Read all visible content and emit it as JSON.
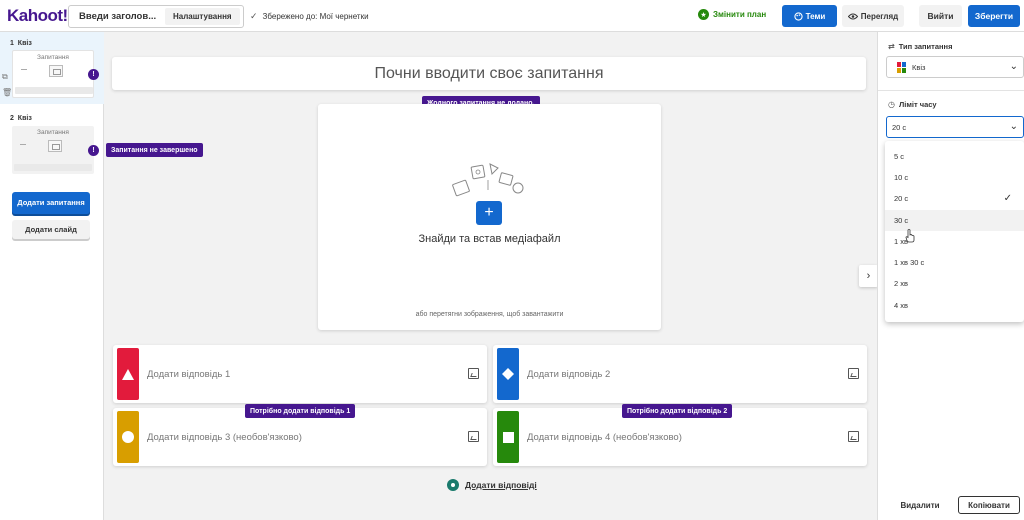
{
  "header": {
    "logo": "Kahoot!",
    "title_input": "Введи заголов...",
    "settings_label": "Налаштування",
    "saved_text": "Збережено до: Мої чернетки",
    "upgrade_label": "Змінити план",
    "themes_label": "Теми",
    "preview_label": "Перегляд",
    "exit_label": "Вийти",
    "save_label": "Зберегти"
  },
  "sidebar": {
    "slides": [
      {
        "number": "1",
        "type": "Квіз",
        "thumb_title": "Запитання",
        "warning_count": "!"
      },
      {
        "number": "2",
        "type": "Квіз",
        "thumb_title": "Запитання",
        "warning_count": "!"
      }
    ],
    "add_question_label": "Додати запитання",
    "add_slide_label": "Додати слайд",
    "incomplete_tooltip": "Запитання не завершено"
  },
  "editor": {
    "question_placeholder": "Почни вводити своє запитання",
    "no_question_tooltip": "Жодного запитання не додано.",
    "media_title": "Знайди та встав медіафайл",
    "media_hint": "або перетягни зображення, щоб завантажити",
    "answers": [
      {
        "placeholder": "Додати відповідь 1",
        "color": "#e21b3c",
        "shape": "triangle"
      },
      {
        "placeholder": "Додати відповідь 2",
        "color": "#1368ce",
        "shape": "diamond"
      },
      {
        "placeholder": "Додати відповідь 3 (необов'язково)",
        "color": "#d89e00",
        "shape": "circle"
      },
      {
        "placeholder": "Додати відповідь 4 (необов'язково)",
        "color": "#26890c",
        "shape": "square"
      }
    ],
    "answer_tooltip_1": "Потрібно додати відповідь 1",
    "answer_tooltip_2": "Потрібно додати відповідь 2",
    "add_answers_label": "Додати відповіді"
  },
  "right_panel": {
    "question_type_label": "Тип запитання",
    "question_type_value": "Квіз",
    "time_limit_label": "Ліміт часу",
    "time_limit_value": "20 с",
    "time_options": [
      "5 с",
      "10 с",
      "20 с",
      "30 с",
      "1 хв",
      "1 хв 30 с",
      "2 хв",
      "4 хв"
    ],
    "selected_option": "20 с",
    "hovered_option": "30 с",
    "delete_label": "Видалити",
    "duplicate_label": "Копіювати"
  }
}
